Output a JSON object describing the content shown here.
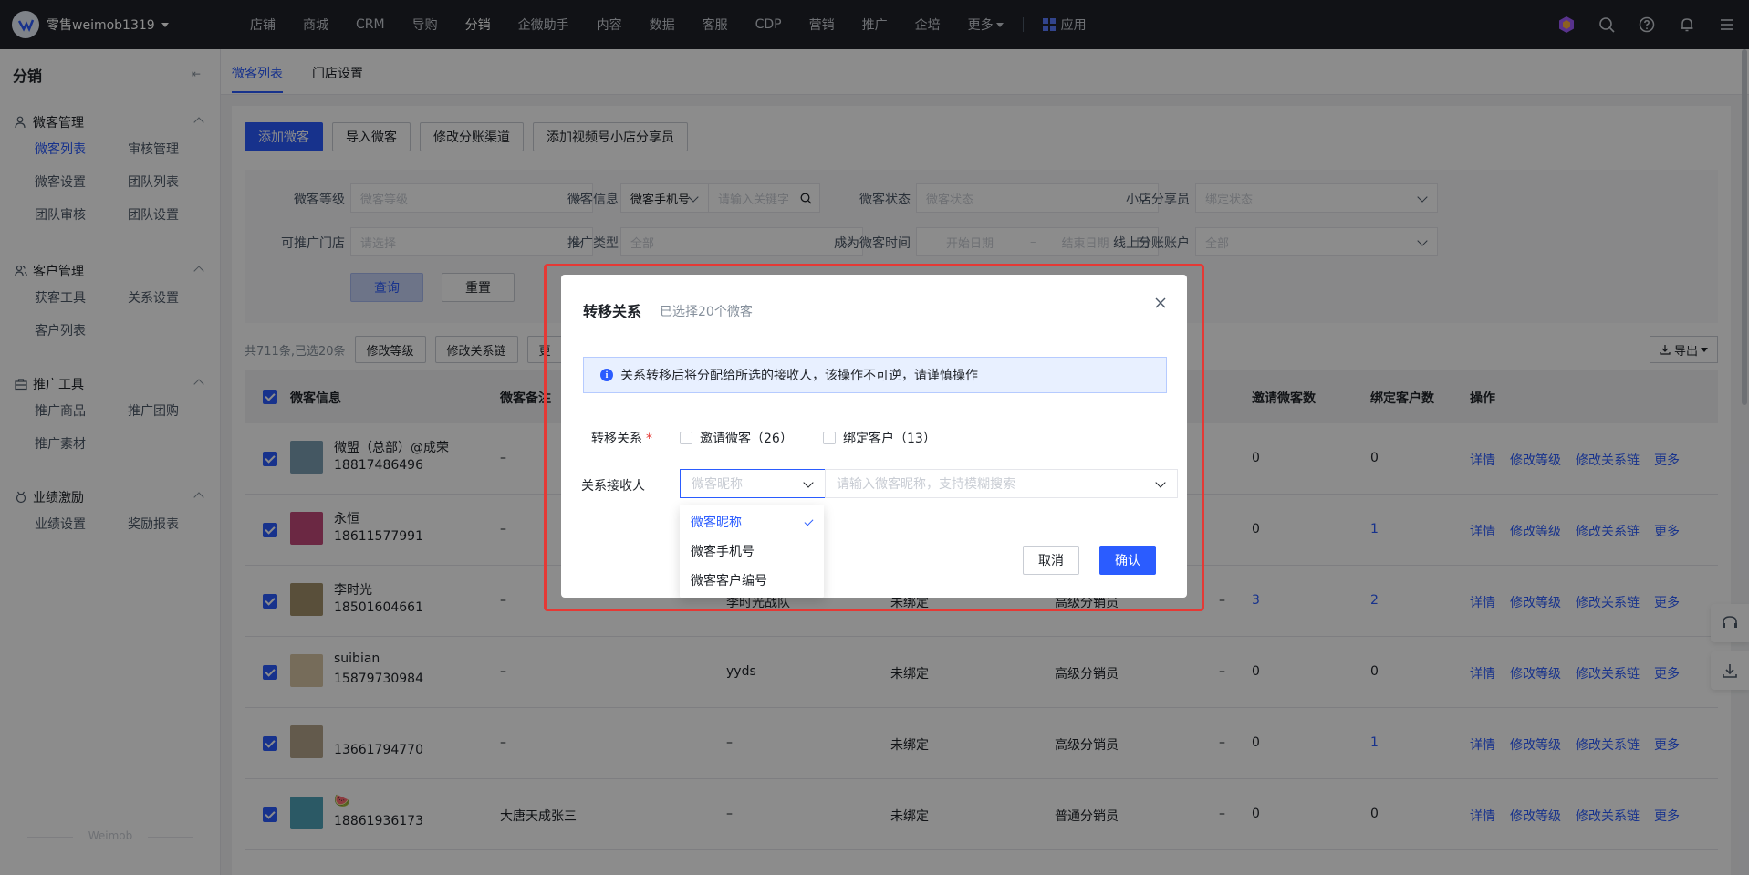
{
  "topbar": {
    "brand": "零售weimob1319",
    "nav": [
      "店铺",
      "商城",
      "CRM",
      "导购",
      "分销",
      "企微助手",
      "内容",
      "数据",
      "客服",
      "CDP",
      "营销",
      "推广",
      "企培",
      "更多"
    ],
    "active_nav": "分销",
    "apps_label": "应用"
  },
  "sidebar": {
    "title": "分销",
    "groups": [
      {
        "label": "微客管理",
        "items": [
          "微客列表",
          "审核管理",
          "微客设置",
          "团队列表",
          "团队审核",
          "团队设置"
        ]
      },
      {
        "label": "客户管理",
        "items": [
          "获客工具",
          "关系设置",
          "客户列表"
        ]
      },
      {
        "label": "推广工具",
        "items": [
          "推广商品",
          "推广团购",
          "推广素材"
        ]
      },
      {
        "label": "业绩激励",
        "items": [
          "业绩设置",
          "奖励报表"
        ]
      }
    ],
    "footer": "Weimob"
  },
  "tabs": [
    "微客列表",
    "门店设置"
  ],
  "actions": [
    "添加微客",
    "导入微客",
    "修改分账渠道",
    "添加视频号小店分享员"
  ],
  "filters": {
    "level_label": "微客等级",
    "level_ph": "微客等级",
    "info_label": "微客信息",
    "info_type": "微客手机号",
    "info_ph": "请输入关键字",
    "status_label": "微客状态",
    "status_ph": "微客状态",
    "share_label": "小店分享员",
    "share_ph": "绑定状态",
    "store_label": "可推广门店",
    "store_ph": "请选择",
    "promo_label": "推广类型",
    "promo_value": "全部",
    "time_label": "成为微客时间",
    "start_ph": "开始日期",
    "end_ph": "结束日期",
    "range_sep": "–",
    "account_label": "线上分账账户",
    "account_value": "全部",
    "query": "查询",
    "reset": "重置"
  },
  "summary": {
    "text": "共711条,已选20条",
    "btn_level": "修改等级",
    "btn_chain": "修改关系链",
    "btn_more": "更",
    "export": "导出"
  },
  "table": {
    "headers": {
      "info": "微客信息",
      "note": "微客备注",
      "invite": "邀请微客数",
      "bind": "绑定客户数",
      "ops": "操作"
    },
    "rows": [
      {
        "name": "微盟（总部）@成荣",
        "phone": "18817486496",
        "note": "–",
        "team": "",
        "bind": "",
        "level": "",
        "c5": "",
        "invite": "0",
        "bound": "0",
        "avatar_color": "#7c9fb3"
      },
      {
        "name": "永恒",
        "phone": "18611577991",
        "note": "–",
        "team": "",
        "bind": "",
        "level": "",
        "c5": "",
        "invite": "0",
        "bound": "1",
        "avatar_color": "#c44a7a"
      },
      {
        "name": "李时光",
        "phone": "18501604661",
        "note": "–",
        "team": "李时光战队",
        "bind": "未绑定",
        "level": "高级分销员",
        "c5": "–",
        "invite": "3",
        "bound": "2",
        "avatar_color": "#a3906a"
      },
      {
        "name": "suibian",
        "phone": "15879730984",
        "note": "–",
        "team": "yyds",
        "bind": "未绑定",
        "level": "高级分销员",
        "c5": "–",
        "invite": "0",
        "bound": "0",
        "avatar_color": "#d8c5a4"
      },
      {
        "name": "",
        "phone": "13661794770",
        "note": "–",
        "team": "–",
        "bind": "未绑定",
        "level": "高级分销员",
        "c5": "–",
        "invite": "0",
        "bound": "1",
        "avatar_color": "#b5a48a"
      },
      {
        "name": "🍉",
        "phone": "18861936173",
        "note": "大唐天成张三",
        "team": "–",
        "bind": "未绑定",
        "level": "普通分销员",
        "c5": "–",
        "invite": "0",
        "bound": "0",
        "avatar_color": "#4fa3b8"
      }
    ],
    "ops": [
      "详情",
      "修改等级",
      "修改关系链",
      "更多"
    ]
  },
  "modal": {
    "title": "转移关系",
    "subtitle": "已选择20个微客",
    "alert": "关系转移后将分配给所选的接收人，该操作不可逆，请谨慎操作",
    "relation_label": "转移关系",
    "required": "*",
    "opt_invite": "邀请微客（26）",
    "opt_bind": "绑定客户（13）",
    "receiver_label": "关系接收人",
    "search_type": "微客昵称",
    "search_ph": "请输入微客昵称，支持模糊搜索",
    "cancel": "取消",
    "confirm": "确认"
  },
  "dropdown": {
    "options": [
      "微客昵称",
      "微客手机号",
      "微客客户编号"
    ],
    "selected": "微客昵称"
  },
  "colors": {
    "primary": "#2b5cff",
    "highlight": "#e53935"
  }
}
